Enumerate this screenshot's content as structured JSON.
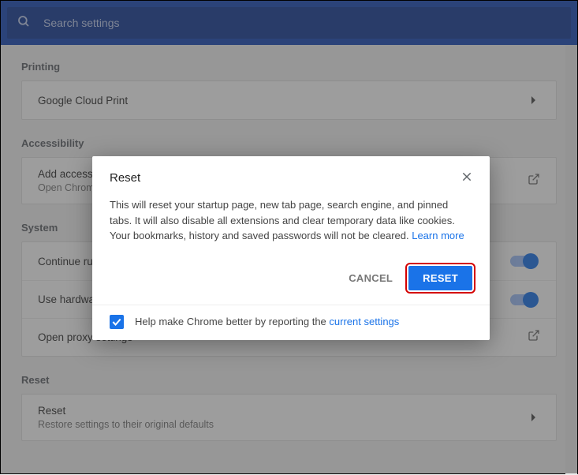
{
  "search": {
    "placeholder": "Search settings"
  },
  "sections": {
    "printing": {
      "title": "Printing",
      "items": [
        {
          "title": "Google Cloud Print"
        }
      ]
    },
    "accessibility": {
      "title": "Accessibility",
      "items": [
        {
          "title": "Add accessibility features",
          "sub": "Open Chrome Web Store"
        }
      ]
    },
    "system": {
      "title": "System",
      "items": [
        {
          "title": "Continue running background apps when Google Chrome is closed"
        },
        {
          "title": "Use hardware acceleration when available"
        },
        {
          "title": "Open proxy settings"
        }
      ]
    },
    "reset": {
      "title": "Reset",
      "items": [
        {
          "title": "Reset",
          "sub": "Restore settings to their original defaults"
        }
      ]
    }
  },
  "dialog": {
    "title": "Reset",
    "body_text": "This will reset your startup page, new tab page, search engine, and pinned tabs. It will also disable all extensions and clear temporary data like cookies. Your bookmarks, history and saved passwords will not be cleared. ",
    "learn_more": "Learn more",
    "cancel": "CANCEL",
    "confirm": "RESET",
    "help_prefix": "Help make Chrome better by reporting the ",
    "help_link": "current settings",
    "help_checked": true
  }
}
